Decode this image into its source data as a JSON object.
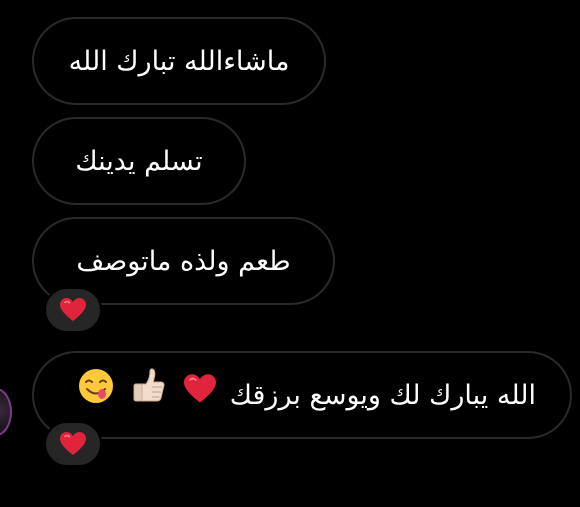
{
  "messages": [
    {
      "text": "ماشاءالله تبارك الله"
    },
    {
      "text": "تسلم يدينك"
    },
    {
      "text": "طعم ولذه ماتوصف",
      "reaction": "heart-icon"
    },
    {
      "text": "الله يبارك لك ويوسع برزقك",
      "emojis": [
        "heart-icon",
        "thumbs-up-icon",
        "yum-face-icon"
      ],
      "reaction": "heart-icon"
    }
  ],
  "colors": {
    "background": "#000000",
    "bubble_border": "#2a2a2a",
    "text": "#ffffff",
    "reaction_bg": "#262626",
    "heart": "#e0243c"
  }
}
